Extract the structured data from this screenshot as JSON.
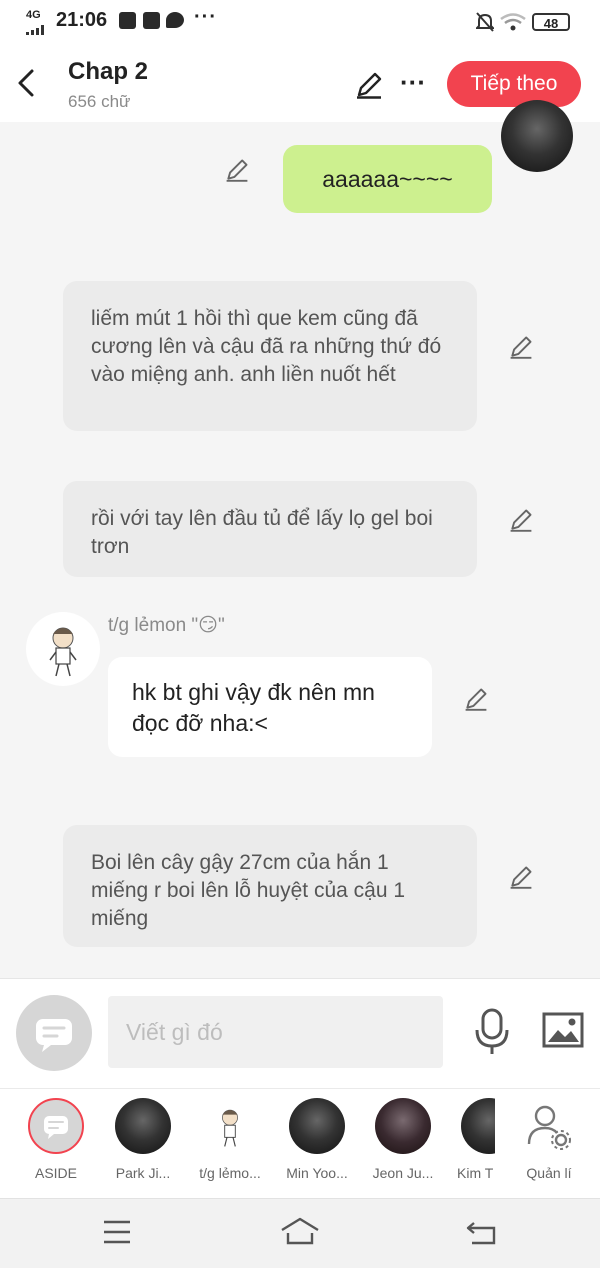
{
  "status_bar": {
    "network": "4G",
    "time": "21:06",
    "battery": "48"
  },
  "header": {
    "title": "Chap 2",
    "word_count": "656 chữ",
    "next_button": "Tiếp theo"
  },
  "messages": [
    {
      "type": "sent",
      "text": "aaaaaa~~~~",
      "color": "#cdf08f"
    },
    {
      "type": "narration",
      "text": "liếm mút 1 hồi thì que kem cũng đã cương lên và cậu đã  ra những thứ đó vào miệng anh. anh liền nuốt hết"
    },
    {
      "type": "narration",
      "text": "rồi với tay lên đầu tủ để lấy lọ gel boi trơn"
    },
    {
      "type": "character",
      "sender": "t/g lẻmon \"😏\"",
      "text": "hk bt ghi vậy đk nên mn đọc đỡ nha:<"
    },
    {
      "type": "narration",
      "text": "Boi lên cây gậy 27cm của hắn 1 miếng r boi lên lỗ huyệt của cậu 1 miếng"
    }
  ],
  "input": {
    "placeholder": "Viết gì đó"
  },
  "characters": [
    {
      "label": "ASIDE"
    },
    {
      "label": "Park Ji..."
    },
    {
      "label": "t/g lẻmo..."
    },
    {
      "label": "Min Yoo..."
    },
    {
      "label": "Jeon Ju..."
    },
    {
      "label": "Kim T"
    },
    {
      "label": "Quản lí"
    }
  ],
  "colors": {
    "accent": "#f2434f",
    "sent_bubble": "#cdf08f",
    "narration_bubble": "#ebebeb"
  }
}
